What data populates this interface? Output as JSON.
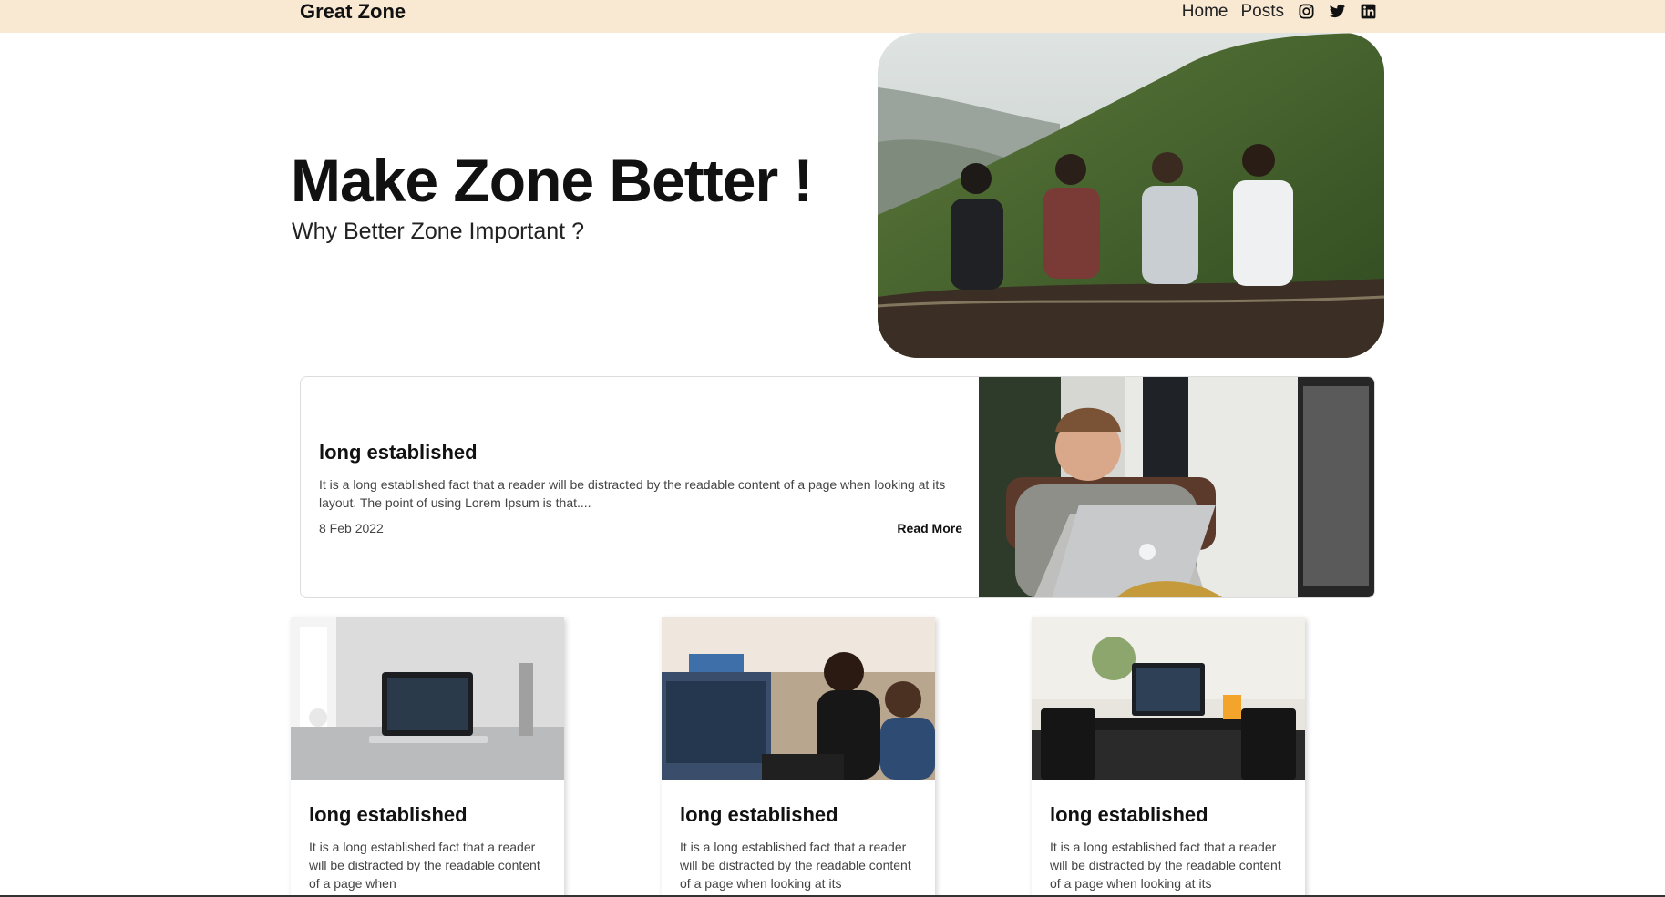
{
  "navbar": {
    "brand": "Great Zone",
    "links": [
      "Home",
      "Posts"
    ],
    "icons": [
      "instagram-icon",
      "twitter-icon",
      "linkedin-icon"
    ],
    "background": "#f9e9d3"
  },
  "hero": {
    "title": "Make Zone Better !",
    "subtitle": "Why Better Zone Important ?"
  },
  "featured": {
    "title": "long established",
    "excerpt": "It is a long established fact that a reader will be distracted by the readable content of a page when looking at its layout. The point of using Lorem Ipsum is that....",
    "date": "8 Feb 2022",
    "read_more": "Read More"
  },
  "cards": [
    {
      "title": "long established",
      "excerpt": "It is a long established fact that a reader will be distracted by the readable content of a page when"
    },
    {
      "title": "long established",
      "excerpt": "It is a long established fact that a reader will be distracted by the readable content of a page when looking at its"
    },
    {
      "title": "long established",
      "excerpt": "It is a long established fact that a reader will be distracted by the readable content of a page when looking at its"
    }
  ]
}
